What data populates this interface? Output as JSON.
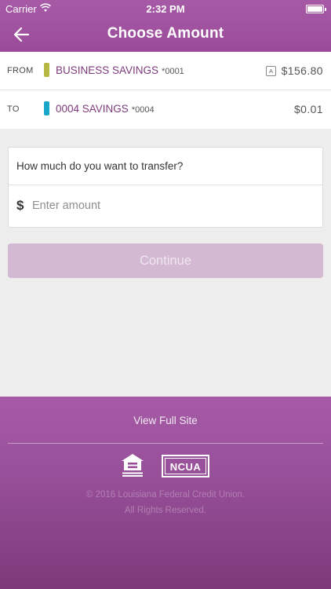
{
  "status_bar": {
    "carrier": "Carrier",
    "time": "2:32 PM"
  },
  "nav": {
    "title": "Choose Amount",
    "back_icon": "back-arrow-icon"
  },
  "transfer": {
    "from": {
      "label": "FROM",
      "account_name": "BUSINESS SAVINGS",
      "account_number": "*0001",
      "balance": "$156.80",
      "badge": "A",
      "color": "#b5b842"
    },
    "to": {
      "label": "TO",
      "account_name": "0004 SAVINGS",
      "account_number": "*0004",
      "balance": "$0.01",
      "color": "#1aa6c9"
    }
  },
  "amount": {
    "question": "How much do you want to transfer?",
    "currency": "$",
    "placeholder": "Enter amount",
    "value": ""
  },
  "continue_label": "Continue",
  "footer": {
    "full_site_link": "View Full Site",
    "logos": [
      "equal-housing-lender-icon",
      "ncua-logo"
    ],
    "ncua_text": "NCUA",
    "copyright": "© 2016 Louisiana Federal Credit Union.",
    "rights": "All Rights Reserved."
  },
  "colors": {
    "brand": "#a65aa6",
    "accent_text": "#7d3a7b",
    "button_disabled": "#d3b9d2"
  }
}
